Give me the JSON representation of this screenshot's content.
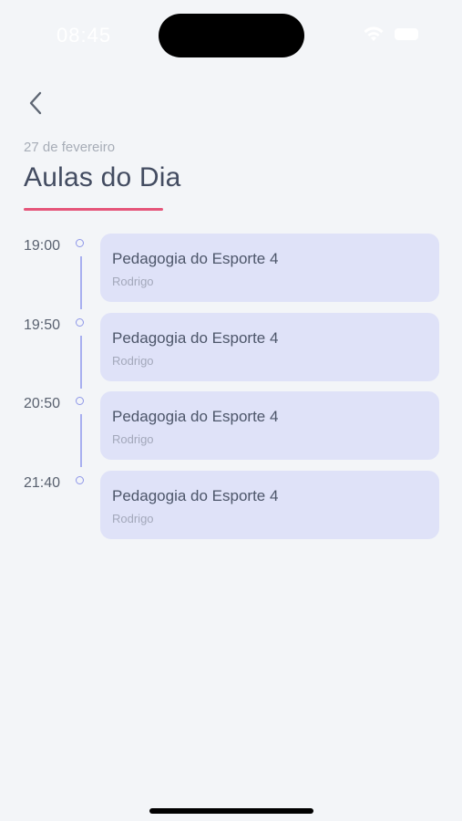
{
  "status_bar": {
    "time": "08:45",
    "wifi_icon": "wifi-icon",
    "battery_icon": "battery-icon"
  },
  "nav": {
    "back_icon": "chevron-left-icon"
  },
  "header": {
    "date": "27 de fevereiro",
    "title": "Aulas do Dia",
    "accent_color": "#e5557a"
  },
  "classes": [
    {
      "time": "19:00",
      "title": "Pedagogia do Esporte 4",
      "teacher": "Rodrigo"
    },
    {
      "time": "19:50",
      "title": "Pedagogia do Esporte 4",
      "teacher": "Rodrigo"
    },
    {
      "time": "20:50",
      "title": "Pedagogia do Esporte 4",
      "teacher": "Rodrigo"
    },
    {
      "time": "21:40",
      "title": "Pedagogia do Esporte 4",
      "teacher": "Rodrigo"
    }
  ],
  "colors": {
    "background": "#f3f5f8",
    "card": "#dfe2f8",
    "timeline": "#a8aff0"
  }
}
